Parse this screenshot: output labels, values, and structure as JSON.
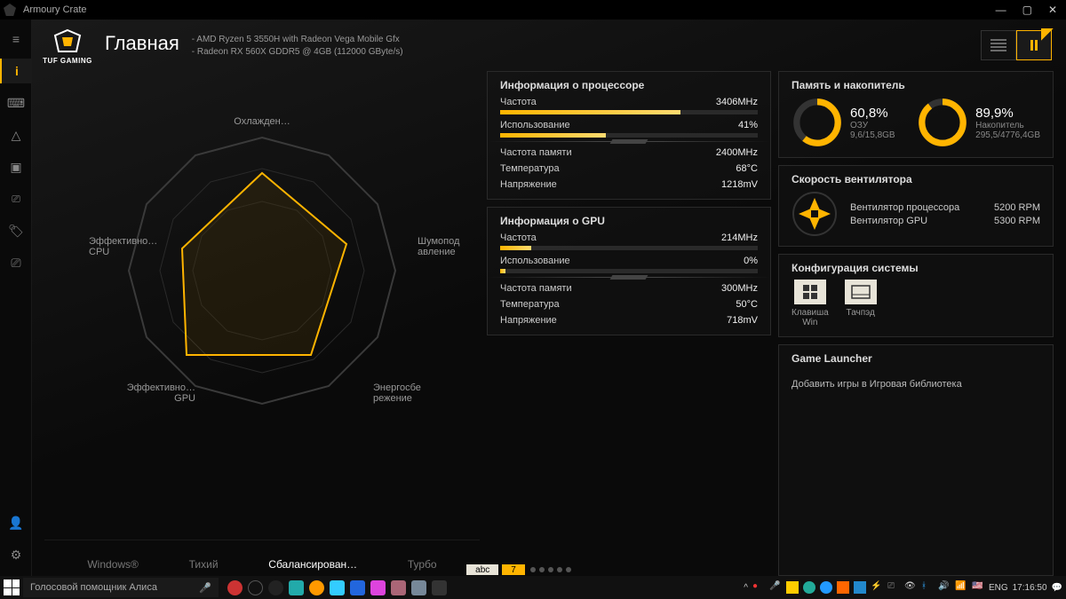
{
  "window": {
    "title": "Armoury Crate"
  },
  "header": {
    "brand": "TUF GAMING",
    "page_title": "Главная",
    "spec1": "-   AMD Ryzen 5 3550H with Radeon Vega Mobile Gfx",
    "spec2": "-   Radeon RX 560X GDDR5 @ 4GB (112000 GByte/s)"
  },
  "radar": {
    "labels": {
      "top": "Охлажден…",
      "right": "Шумопод\nавление",
      "bottom_right": "Энергосбе\nрежение",
      "bottom_left": "Эффективно…\nGPU",
      "left": "Эффективно…\nCPU"
    }
  },
  "modes": {
    "windows": "Windows®",
    "silent": "Тихий",
    "balanced": "Сбалансирован…",
    "turbo": "Турбо",
    "active": "balanced"
  },
  "cpu": {
    "title": "Информация о процессоре",
    "freq_label": "Частота",
    "freq_val": "3406MHz",
    "freq_pct": 70,
    "usage_label": "Использование",
    "usage_val": "41%",
    "usage_pct": 41,
    "memfreq_label": "Частота памяти",
    "memfreq_val": "2400MHz",
    "temp_label": "Температура",
    "temp_val": "68°C",
    "volt_label": "Напряжение",
    "volt_val": "1218mV"
  },
  "gpu": {
    "title": "Информация о GPU",
    "freq_label": "Частота",
    "freq_val": "214MHz",
    "freq_pct": 12,
    "usage_label": "Использование",
    "usage_val": "0%",
    "usage_pct": 0,
    "memfreq_label": "Частота памяти",
    "memfreq_val": "300MHz",
    "temp_label": "Температура",
    "temp_val": "50°C",
    "volt_label": "Напряжение",
    "volt_val": "718mV"
  },
  "memory": {
    "title": "Память и накопитель",
    "ram_pct": "60,8%",
    "ram_pct_num": 60.8,
    "ram_label": "ОЗУ",
    "ram_sub": "9,6/15,8GB",
    "disk_pct": "89,9%",
    "disk_pct_num": 89.9,
    "disk_label": "Накопитель",
    "disk_sub": "295,5/4776,4GB"
  },
  "fan": {
    "title": "Скорость вентилятора",
    "cpu_label": "Вентилятор процессора",
    "cpu_val": "5200 RPM",
    "gpu_label": "Вентилятор GPU",
    "gpu_val": "5300 RPM"
  },
  "config": {
    "title": "Конфигурация системы",
    "winkey": "Клавиша\nWin",
    "touchpad": "Тачпэд"
  },
  "launcher": {
    "title": "Game Launcher",
    "text": "Добавить игры в Игровая библиотека"
  },
  "bottom_strip": {
    "abc": "abc",
    "seven": "7"
  },
  "taskbar": {
    "search": "Голосовой помощник Алиса",
    "lang": "ENG",
    "time": "17:16:50"
  },
  "colors": {
    "accent": "#ffb400"
  }
}
